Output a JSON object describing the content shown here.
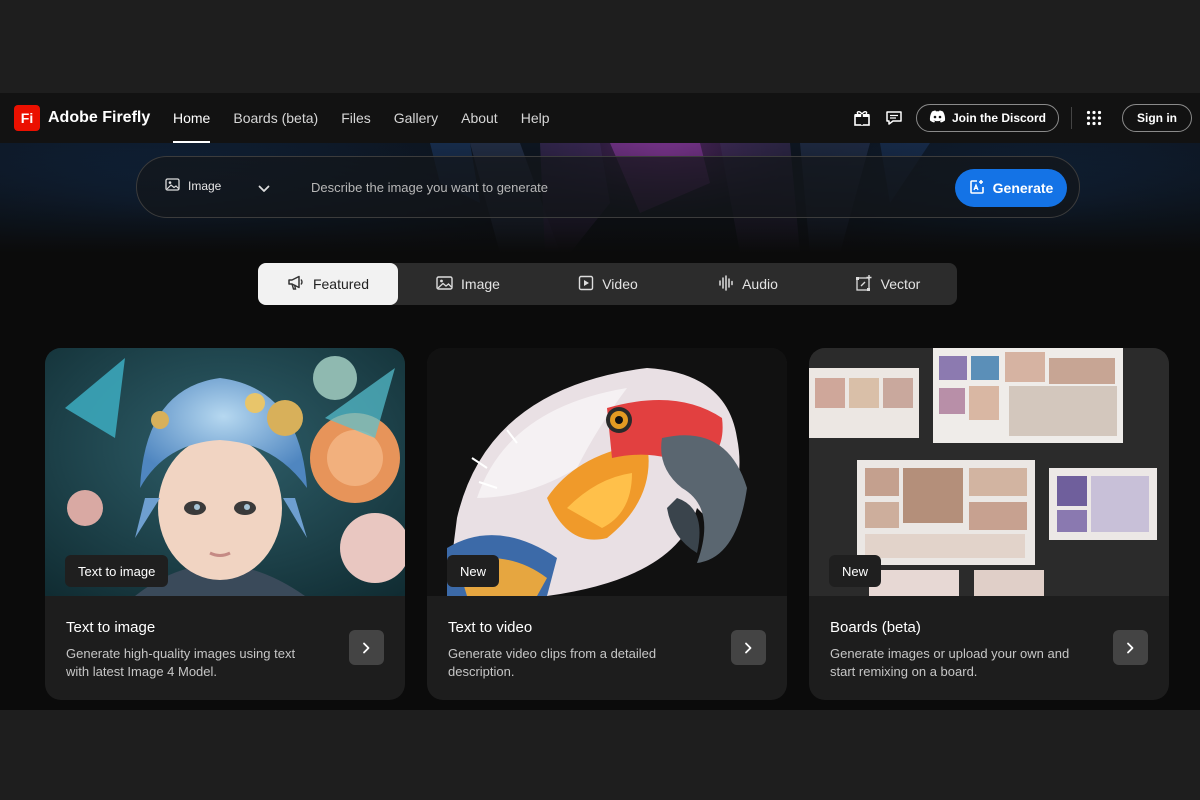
{
  "brand": {
    "logo": "Fi",
    "name": "Adobe Firefly"
  },
  "nav": {
    "links": [
      "Home",
      "Boards (beta)",
      "Files",
      "Gallery",
      "About",
      "Help"
    ],
    "active": "Home",
    "discord_label": "Join the Discord",
    "signin_label": "Sign in",
    "icons": [
      "gift-icon",
      "chat-icon",
      "discord-icon",
      "apps-grid-icon"
    ]
  },
  "prompt": {
    "type_label": "Image",
    "placeholder": "Describe the image you want to generate",
    "generate_label": "Generate"
  },
  "tabs": [
    {
      "label": "Featured",
      "icon": "megaphone-icon",
      "active": true
    },
    {
      "label": "Image",
      "icon": "image-icon",
      "active": false
    },
    {
      "label": "Video",
      "icon": "video-icon",
      "active": false
    },
    {
      "label": "Audio",
      "icon": "audio-icon",
      "active": false
    },
    {
      "label": "Vector",
      "icon": "vector-icon",
      "active": false
    }
  ],
  "cards": [
    {
      "badge": "Text to image",
      "title": "Text to image",
      "description": "Generate high-quality images using text with latest Image 4 Model."
    },
    {
      "badge": "New",
      "title": "Text to video",
      "description": "Generate video clips from a detailed description."
    },
    {
      "badge": "New",
      "title": "Boards (beta)",
      "description": "Generate images or upload your own and start remixing on a board."
    }
  ],
  "colors": {
    "accent": "#1473e6",
    "brand": "#eb1000"
  }
}
